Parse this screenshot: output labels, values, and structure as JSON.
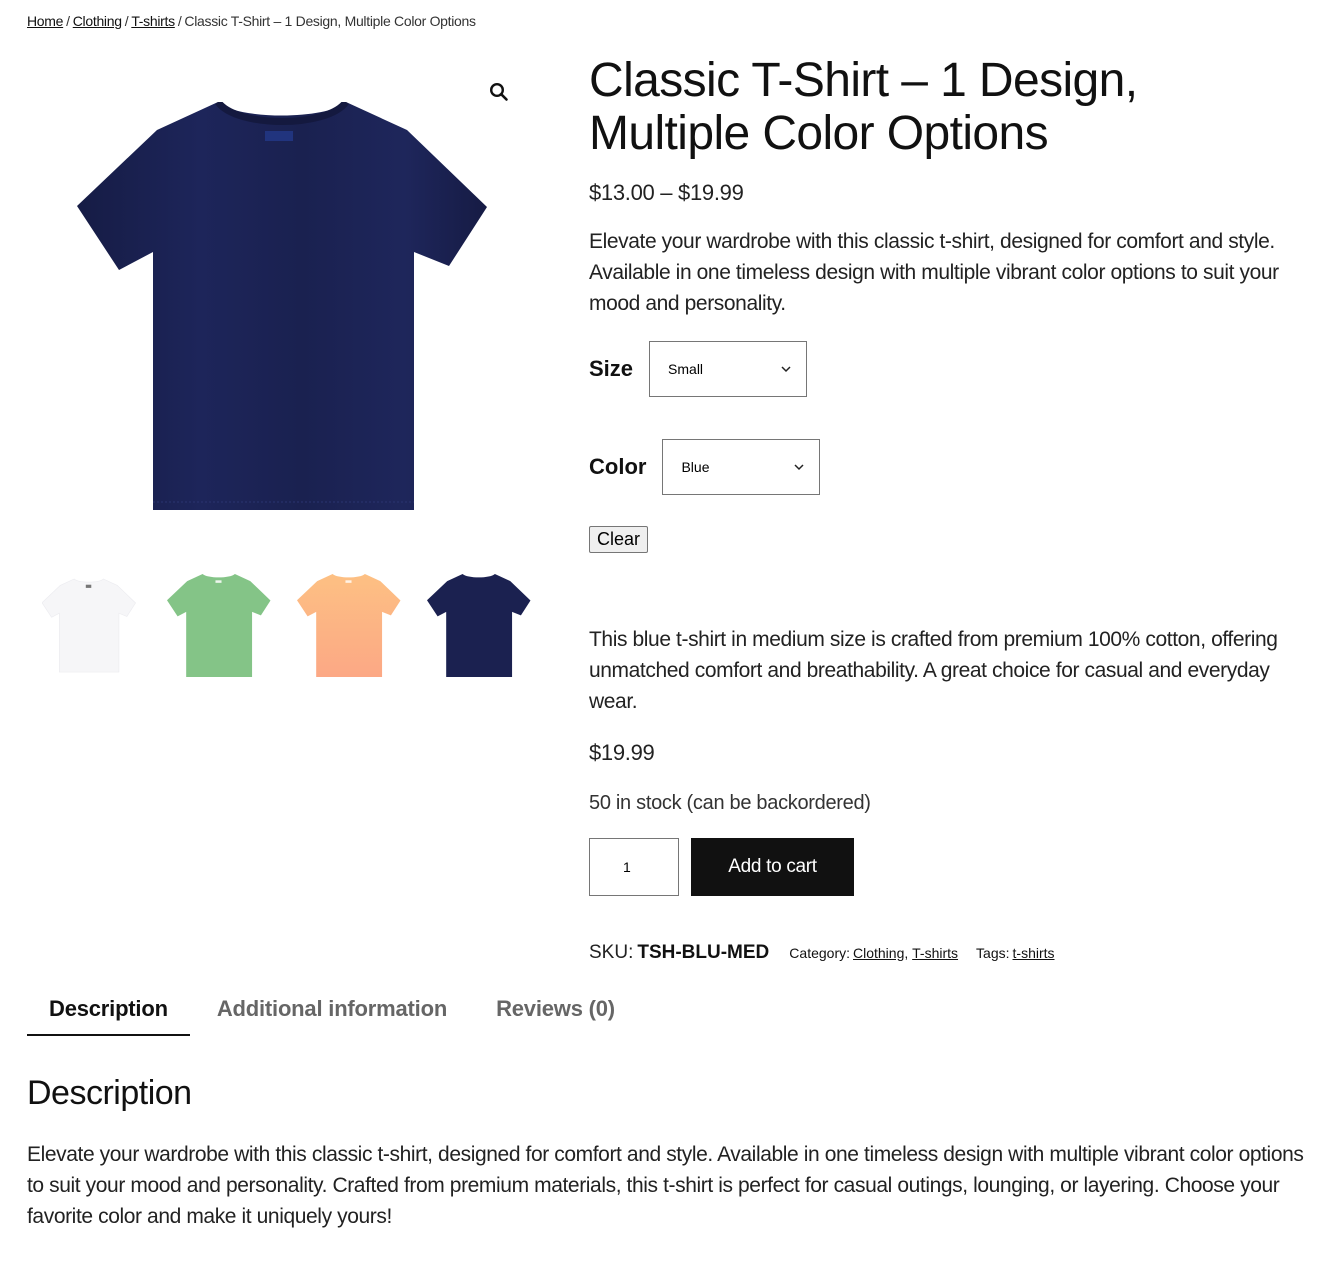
{
  "breadcrumb": {
    "items": [
      {
        "label": "Home",
        "link": true
      },
      {
        "label": "Clothing",
        "link": true
      },
      {
        "label": "T-shirts",
        "link": true
      },
      {
        "label": "Classic T-Shirt – 1 Design, Multiple Color Options",
        "link": false
      }
    ],
    "separator": "/"
  },
  "gallery": {
    "zoom_icon": "magnifier-icon",
    "main_image_color": "#1b2150",
    "thumbnails": [
      {
        "name": "white",
        "color": "#f7f7f8"
      },
      {
        "name": "green",
        "color": "#84c487"
      },
      {
        "name": "orange",
        "color": "#fdb683"
      },
      {
        "name": "navy",
        "color": "#1b2150"
      }
    ]
  },
  "product": {
    "title": "Classic T-Shirt – 1 Design, Multiple Color Options",
    "price_range": "$13.00 – $19.99",
    "short_description": "Elevate your wardrobe with this classic t-shirt, designed for comfort and style. Available in one timeless design with multiple vibrant color options to suit your mood and personality."
  },
  "variations": {
    "size": {
      "label": "Size",
      "selected": "Small"
    },
    "color": {
      "label": "Color",
      "selected": "Blue"
    },
    "clear_label": "Clear"
  },
  "variation_info": {
    "description": "This blue t-shirt in medium size is crafted from premium 100% cotton, offering unmatched comfort and breathability. A great choice for casual and everyday wear.",
    "price": "$19.99",
    "stock": "50 in stock (can be backordered)"
  },
  "cart": {
    "quantity": "1",
    "add_to_cart_label": "Add to cart"
  },
  "meta": {
    "sku_label": "SKU:",
    "sku_value": "TSH-BLU-MED",
    "category_label": "Category:",
    "categories": [
      "Clothing",
      "T-shirts"
    ],
    "tags_label": "Tags:",
    "tags": [
      "t-shirts"
    ]
  },
  "tabs": [
    {
      "label": "Description",
      "active": true
    },
    {
      "label": "Additional information",
      "active": false
    },
    {
      "label": "Reviews (0)",
      "active": false
    }
  ],
  "description_panel": {
    "heading": "Description",
    "body": "Elevate your wardrobe with this classic t-shirt, designed for comfort and style. Available in one timeless design with multiple vibrant color options to suit your mood and personality. Crafted from premium materials, this t-shirt is perfect for casual outings, lounging, or layering. Choose your favorite color and make it uniquely yours!"
  }
}
